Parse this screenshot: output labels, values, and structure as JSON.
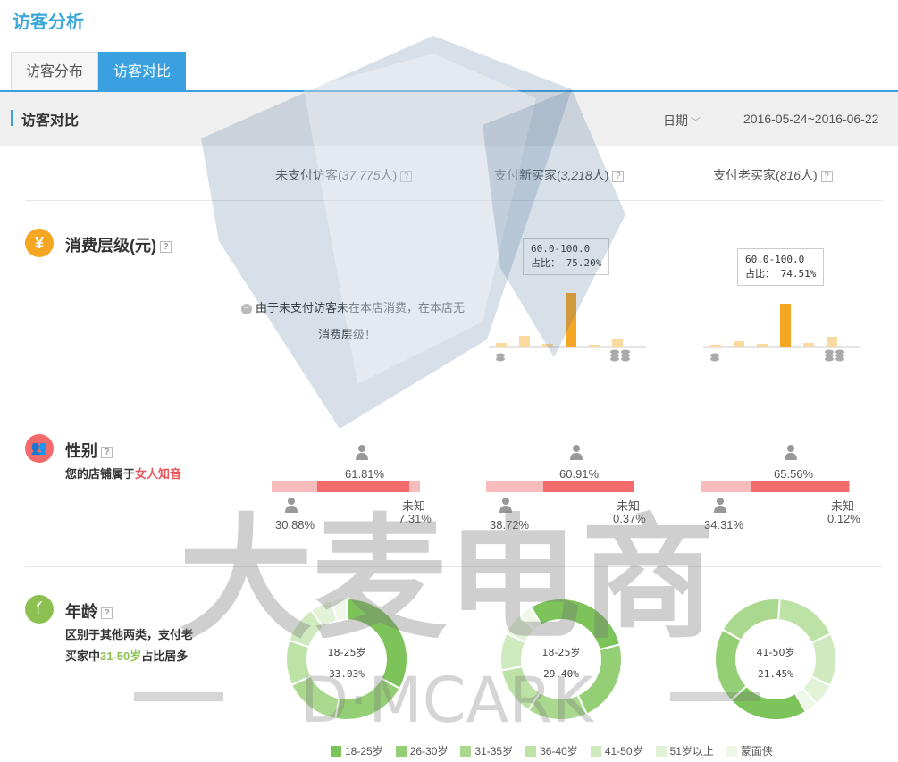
{
  "page": {
    "title": "访客分析"
  },
  "tabs": [
    {
      "label": "访客分布",
      "active": false
    },
    {
      "label": "访客对比",
      "active": true
    }
  ],
  "section": {
    "title": "访客对比",
    "date_label": "日期",
    "date_range": "2016-05-24~2016-06-22"
  },
  "columns": [
    {
      "name": "未支付访客",
      "count": "37,775",
      "unit": "人"
    },
    {
      "name": "支付新买家",
      "count": "3,218",
      "unit": "人"
    },
    {
      "name": "支付老买家",
      "count": "816",
      "unit": "人"
    }
  ],
  "consumption": {
    "title": "消费层级(元)",
    "icon": "yen-icon",
    "note_line1": "由于未支付访客未在本店消费，在本店无",
    "note_line2": "消费层级！",
    "tooltip_new": {
      "range": "60.0-100.0",
      "share_label": "占比：",
      "share": "75.20%"
    },
    "tooltip_old": {
      "range": "60.0-100.0",
      "share_label": "占比：",
      "share": "74.51%"
    }
  },
  "gender": {
    "title": "性别",
    "icon": "people-icon",
    "desc_prefix": "您的店铺属于",
    "desc_highlight": "女人知音",
    "unknown_label": "未知",
    "groups": [
      {
        "female": "61.81%",
        "male": "30.88%",
        "unknown": "7.31%",
        "female_v": 61.81,
        "male_v": 30.88,
        "unknown_v": 7.31
      },
      {
        "female": "60.91%",
        "male": "38.72%",
        "unknown": "0.37%",
        "female_v": 60.91,
        "male_v": 38.72,
        "unknown_v": 0.37
      },
      {
        "female": "65.56%",
        "male": "34.31%",
        "unknown": "0.12%",
        "female_v": 65.56,
        "male_v": 34.31,
        "unknown_v": 0.12
      }
    ]
  },
  "age": {
    "title": "年龄",
    "icon": "family-icon",
    "desc_line1": "区别于其他两类，支付老",
    "desc_line2_pre": "买家中",
    "desc_line2_hl": "31-50岁",
    "desc_line2_post": "占比居多",
    "donuts": [
      {
        "label": "18-25岁",
        "value": "33.03%"
      },
      {
        "label": "18-25岁",
        "value": "29.40%"
      },
      {
        "label": "41-50岁",
        "value": "21.45%"
      }
    ],
    "legend": [
      "18-25岁",
      "26-30岁",
      "31-35岁",
      "36-40岁",
      "41-50岁",
      "51岁以上",
      "蒙面侠"
    ],
    "legend_colors": [
      "#7cc45a",
      "#95cf75",
      "#a9d88e",
      "#bde2a6",
      "#cfeabf",
      "#e1f2d6",
      "#eef7e8"
    ]
  },
  "watermark": {
    "text_cn": "大麦电商",
    "text_en": "D·MCARK"
  },
  "colors": {
    "accent": "#3aa0e0",
    "orange": "#f5a623",
    "female": "#f26a6a",
    "male": "#f8bcbc",
    "green": "#8cc152"
  }
}
